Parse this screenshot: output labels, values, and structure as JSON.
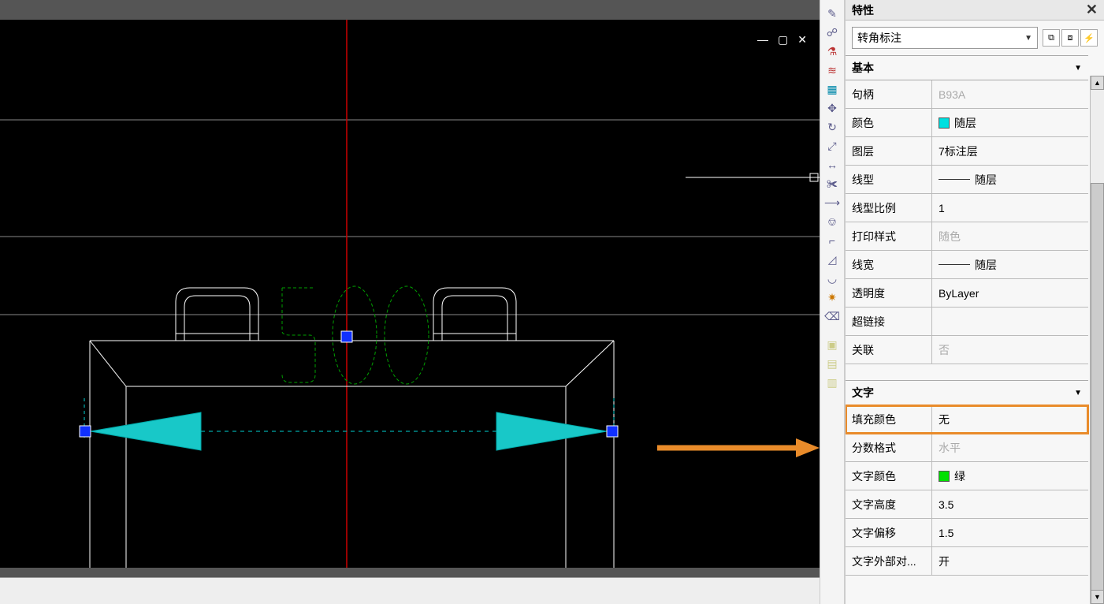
{
  "panel": {
    "title": "特性",
    "typeSelector": "转角标注"
  },
  "section_basic": {
    "title": "基本",
    "rows": {
      "handle": {
        "label": "句柄",
        "value": "B93A"
      },
      "color": {
        "label": "颜色",
        "value": "随层",
        "swatch": "#00e0e0"
      },
      "layer": {
        "label": "图层",
        "value": "7标注层"
      },
      "linetype": {
        "label": "线型",
        "value": "随层"
      },
      "ltscale": {
        "label": "线型比例",
        "value": "1"
      },
      "plotstyle": {
        "label": "打印样式",
        "value": "随色"
      },
      "lineweight": {
        "label": "线宽",
        "value": "随层"
      },
      "transparency": {
        "label": "透明度",
        "value": "ByLayer"
      },
      "hyperlink": {
        "label": "超链接",
        "value": ""
      },
      "associative": {
        "label": "关联",
        "value": "否"
      }
    }
  },
  "section_text": {
    "title": "文字",
    "rows": {
      "fillcolor": {
        "label": "填充颜色",
        "value": "无"
      },
      "fracformat": {
        "label": "分数格式",
        "value": "水平"
      },
      "textcolor": {
        "label": "文字颜色",
        "value": "绿",
        "swatch": "#00e000"
      },
      "textheight": {
        "label": "文字高度",
        "value": "3.5"
      },
      "textoffset": {
        "label": "文字偏移",
        "value": "1.5"
      },
      "textoutside": {
        "label": "文字外部对...",
        "value": "开"
      }
    }
  },
  "drawing": {
    "dimension_text": "500"
  }
}
